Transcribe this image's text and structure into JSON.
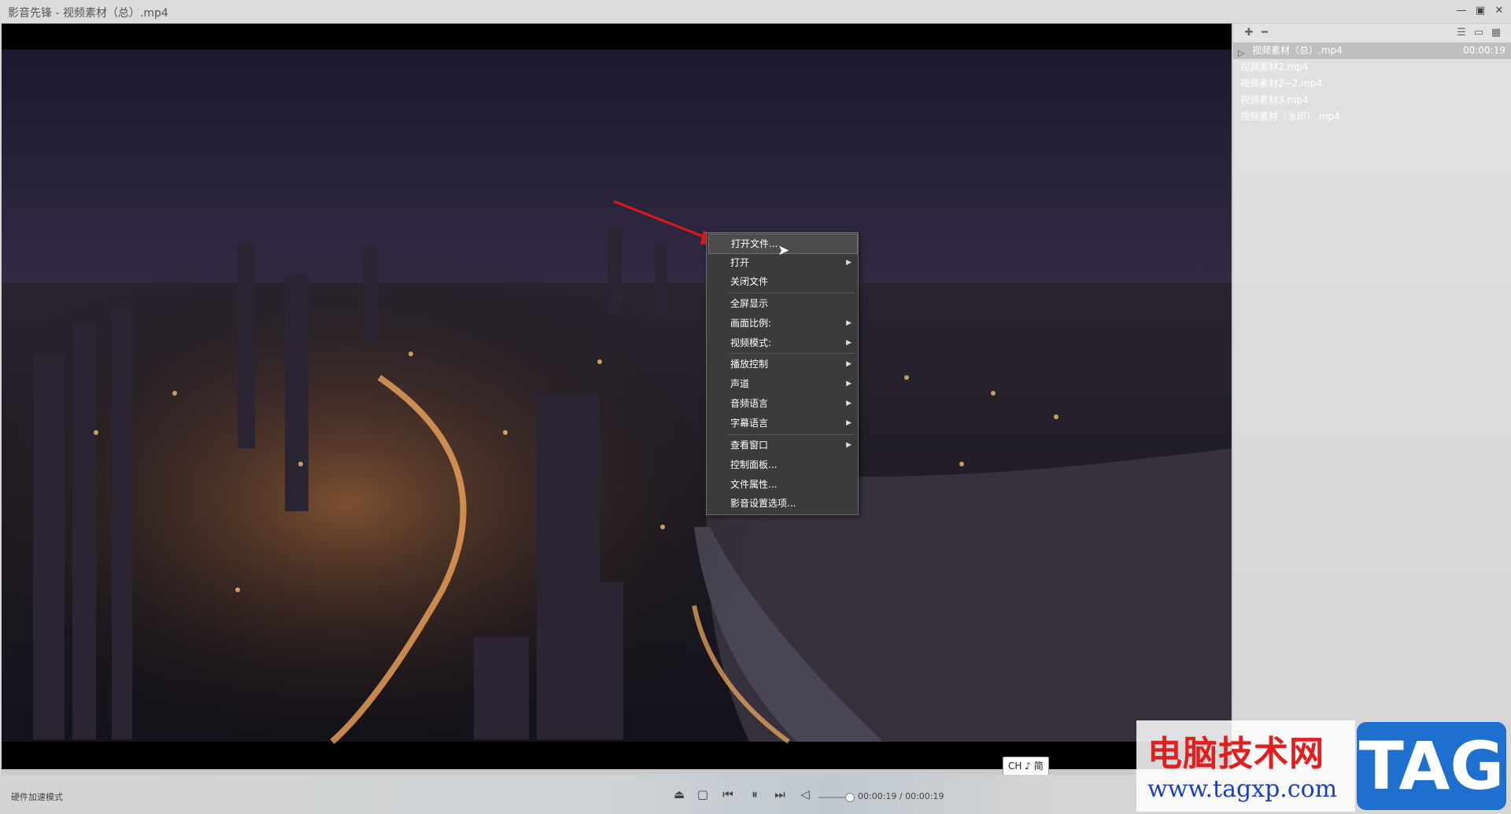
{
  "window": {
    "title": "影音先锋 - 视频素材（总）.mp4",
    "min_icon": "minimize-icon",
    "max_icon": "restore-icon",
    "close_icon": "close-icon"
  },
  "playlist": {
    "toolbar_icons": [
      "add-icon",
      "remove-icon",
      "list-view-icon",
      "screen-icon",
      "grid-view-icon"
    ],
    "items": [
      {
        "name": "视频素材（总）.mp4",
        "duration": "00:00:19",
        "active": true
      },
      {
        "name": "视频素材2.mp4",
        "duration": ""
      },
      {
        "name": "视频素材2~2.mp4",
        "duration": ""
      },
      {
        "name": "视频素材3.mp4",
        "duration": ""
      },
      {
        "name": "视频素材（水印）.mp4",
        "duration": ""
      }
    ]
  },
  "context_menu": {
    "items": [
      {
        "label": "打开文件...",
        "submenu": false,
        "highlighted": true
      },
      {
        "label": "打开",
        "submenu": true
      },
      {
        "label": "关闭文件",
        "submenu": false
      },
      {
        "label": "全屏显示",
        "submenu": false
      },
      {
        "label": "画面比例:",
        "submenu": true
      },
      {
        "label": "视频模式:",
        "submenu": true
      },
      {
        "label": "播放控制",
        "submenu": true
      },
      {
        "label": "声道",
        "submenu": true
      },
      {
        "label": "音频语言",
        "submenu": true
      },
      {
        "label": "字幕语言",
        "submenu": true
      },
      {
        "label": "查看窗口",
        "submenu": true
      },
      {
        "label": "控制面板...",
        "submenu": false
      },
      {
        "label": "文件属性...",
        "submenu": false
      },
      {
        "label": "影音设置选项...",
        "submenu": false
      }
    ]
  },
  "controls": {
    "hw_mode": "硬件加速模式",
    "timecode": "00:00:19 / 00:00:19",
    "ime": "CH ♪ 简",
    "volume_level": 0.85
  },
  "watermark": {
    "cn": "电脑技术网",
    "url": "www.tagxp.com",
    "tag": "TAG"
  },
  "colors": {
    "menu_bg": "#3b3b3b",
    "accent_red": "#e02020",
    "arrow_red": "#e01818"
  }
}
